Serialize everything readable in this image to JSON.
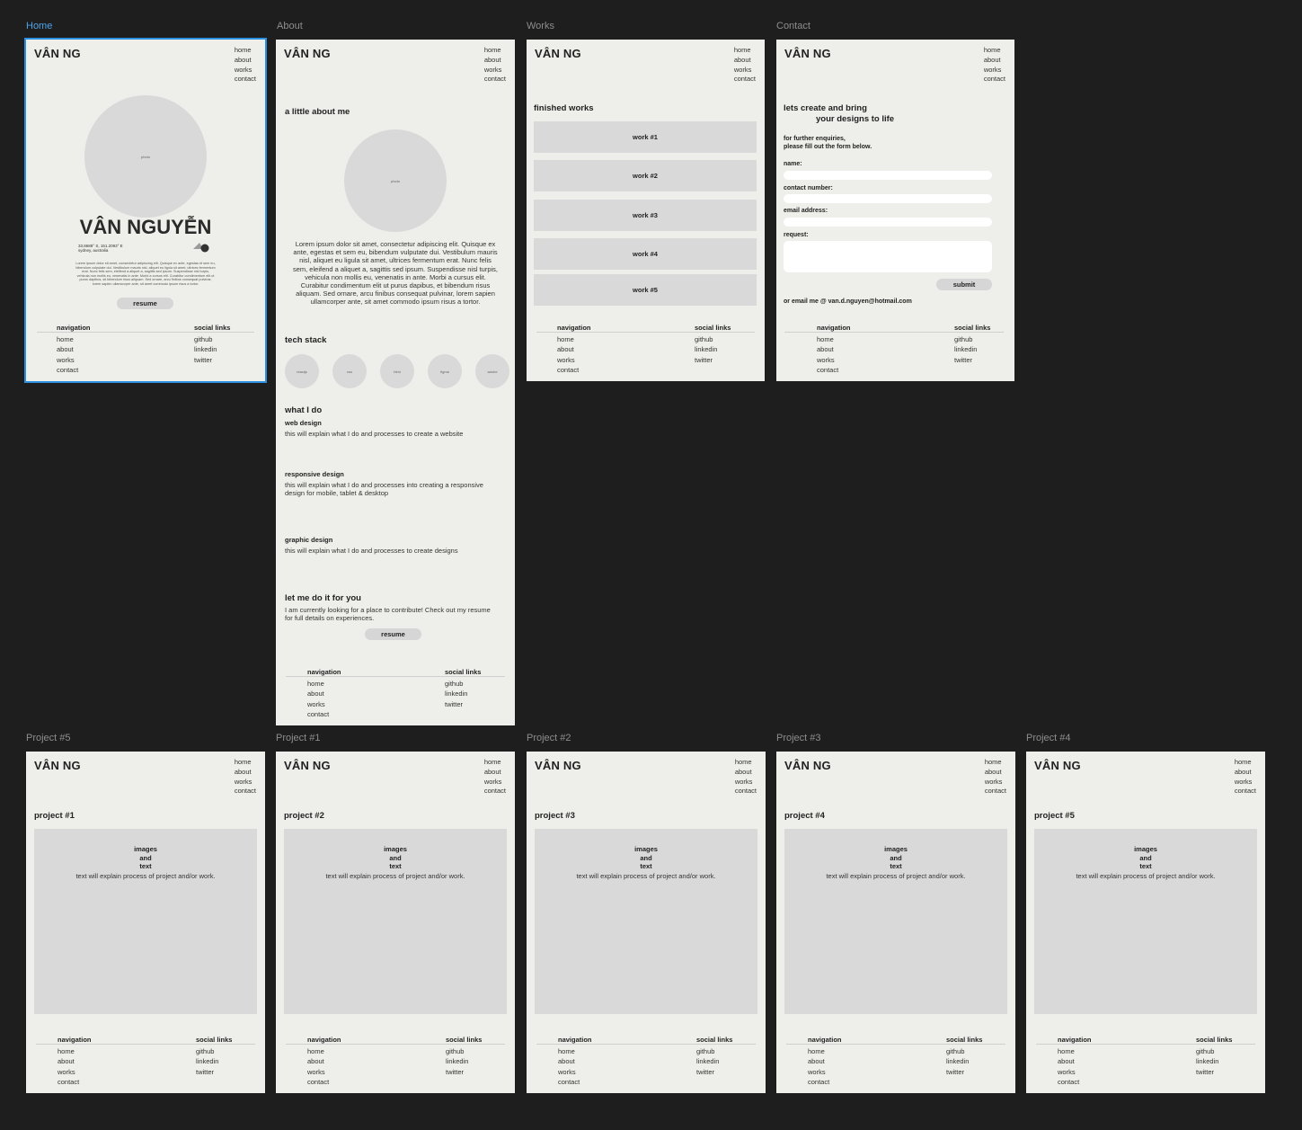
{
  "site": {
    "logo": "VÂN NG",
    "nav": [
      "home",
      "about",
      "works",
      "contact"
    ],
    "footer": {
      "nav_heading": "navigation",
      "nav_items": [
        "home",
        "about",
        "works",
        "contact"
      ],
      "social_heading": "social links",
      "social_items": [
        "github",
        "linkedin",
        "twitter"
      ]
    }
  },
  "frames": {
    "home": {
      "label": "Home",
      "photo_label": "photo",
      "name": "VÂN NGUYỄN",
      "coords": "33.8688° S, 151.2093° E",
      "location": "sydney, australia",
      "blurb": "Lorem ipsum dolor sit amet, consectetur adipiscing elit. Quisque ex ante, egestas et sem eu, bibendum vulputate dui. Vestibulum mauris nisl, aliquet eu ligula sit amet, ultrices fermentum erat. Nunc felis sem, eleifend a aliquet a, sagittis sed ipsum. Suspendisse nisl turpis, vehicula non mollis eu, venenatis in ante. Morbi a cursus elit. Curabitur condimentum elit ut purus dapibus, sit bibendum risus aliquam. Sed ornare, arcu finibus consequat pulvinar, lorem sapien ullamcorper ante, sit amet commodo ipsum risus a tortor.",
      "resume": "resume"
    },
    "about": {
      "label": "About",
      "heading": "a little about me",
      "photo_label": "photo",
      "bio": "Lorem ipsum dolor sit amet, consectetur adipiscing elit. Quisque ex ante, egestas et sem eu, bibendum vulputate dui. Vestibulum mauris nisl, aliquet eu ligula sit amet, ultrices fermentum erat. Nunc felis sem, eleifend a aliquet a, sagittis sed ipsum. Suspendisse nisl turpis, vehicula non mollis eu, venenatis in ante. Morbi a cursus elit. Curabitur condimentum elit ut purus dapibus, et bibendum risus aliquam. Sed ornare, arcu finibus consequat pulvinar, lorem sapien ullamcorper ante, sit amet commodo ipsum risus a tortor.",
      "tech_heading": "tech stack",
      "tech": [
        "reactjs",
        "css",
        "html",
        "figma",
        "adobe"
      ],
      "what_heading": "what I do",
      "services": [
        {
          "title": "web design",
          "desc": "this will explain what I do and processes to create a website"
        },
        {
          "title": "responsive design",
          "desc": "this will explain what I do and processes into creating a responsive design for mobile, tablet & desktop"
        },
        {
          "title": "graphic design",
          "desc": "this will explain what I do and processes to create designs"
        }
      ],
      "cta_heading": "let me do it for you",
      "cta_text": "I am currently looking for a place to contribute! Check out my resume for full details on experiences.",
      "resume": "resume"
    },
    "works": {
      "label": "Works",
      "heading": "finished works",
      "items": [
        "work #1",
        "work #2",
        "work #3",
        "work #4",
        "work #5"
      ]
    },
    "contact": {
      "label": "Contact",
      "heading_line1": "lets create and bring",
      "heading_line2": "your designs to life",
      "intro_line1": "for further enquiries,",
      "intro_line2": "please fill out the form below.",
      "fields": [
        "name:",
        "contact number:",
        "email address:",
        "request:"
      ],
      "submit": "submit",
      "email_line": "or email me @ van.d.nguyen@hotmail.com"
    },
    "projects": [
      {
        "label": "Project #5",
        "title": "project #1"
      },
      {
        "label": "Project #1",
        "title": "project #2"
      },
      {
        "label": "Project #2",
        "title": "project #3"
      },
      {
        "label": "Project #3",
        "title": "project #4"
      },
      {
        "label": "Project #4",
        "title": "project #5"
      }
    ],
    "project_content": {
      "images_line1": "images",
      "images_line2": "and",
      "images_line3": "text",
      "desc": "text will explain process of project and/or work."
    }
  }
}
